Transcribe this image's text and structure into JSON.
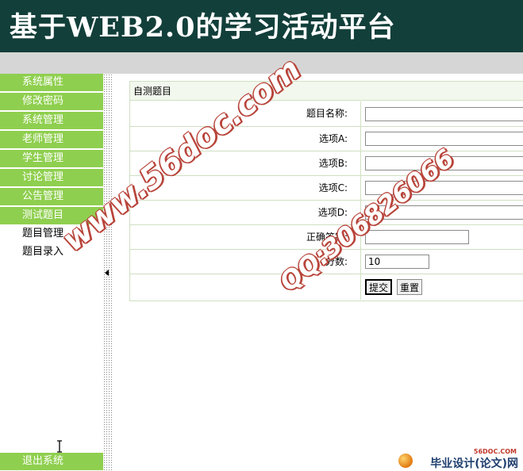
{
  "app": {
    "title": "基于WEB2.0的学习活动平台"
  },
  "sidebar": {
    "items": [
      {
        "label": "系统属性"
      },
      {
        "label": "修改密码"
      },
      {
        "label": "系统管理"
      },
      {
        "label": "老师管理"
      },
      {
        "label": "学生管理"
      },
      {
        "label": "讨论管理"
      },
      {
        "label": "公告管理"
      },
      {
        "label": "测试题目"
      }
    ],
    "subitems": [
      {
        "label": "题目管理"
      },
      {
        "label": "题目录入"
      }
    ],
    "logout": "退出系统"
  },
  "form": {
    "header": "自测题目",
    "fields": [
      {
        "label": "题目名称:",
        "value": ""
      },
      {
        "label": "选项A:",
        "value": ""
      },
      {
        "label": "选项B:",
        "value": ""
      },
      {
        "label": "选项C:",
        "value": ""
      },
      {
        "label": "选项D:",
        "value": ""
      },
      {
        "label": "正确答案:",
        "value": ""
      },
      {
        "label": "分数:",
        "value": "10"
      }
    ],
    "submit": "提交",
    "reset": "重置"
  },
  "watermark": {
    "url": "www.56doc.com",
    "qq": "QQ:306826066"
  },
  "corner_logo": {
    "small": "56DOC.COM",
    "text": "毕业设计(论文)网"
  },
  "colors": {
    "header": "#123f3a",
    "menu": "#8fcf4f",
    "panel_border": "#cfe0c2"
  }
}
